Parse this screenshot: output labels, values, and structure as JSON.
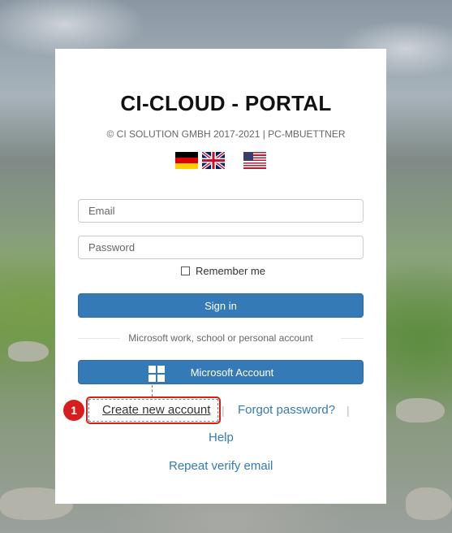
{
  "header": {
    "title": "CI-CLOUD - PORTAL",
    "copyright": "© CI SOLUTION GMBH 2017-2021 | PC-MBUETTNER"
  },
  "languages": [
    {
      "name": "german-flag-icon"
    },
    {
      "name": "uk-flag-icon"
    },
    {
      "name": "us-flag-icon"
    }
  ],
  "login": {
    "email_placeholder": "Email",
    "email_value": "",
    "password_placeholder": "Password",
    "password_value": "",
    "remember_label": "Remember me",
    "remember_checked": false,
    "signin_label": "Sign in",
    "divider_text": "Microsoft work, school or personal account",
    "microsoft_label": "Microsoft Account"
  },
  "links": {
    "create_account": "Create new account",
    "forgot_password": "Forgot password?",
    "separator": "|",
    "help": "Help",
    "repeat_verify": "Repeat verify email"
  },
  "annotation": {
    "step_number": "1"
  },
  "colors": {
    "primary": "#337ab7",
    "annotation_red": "#d61e1e"
  }
}
